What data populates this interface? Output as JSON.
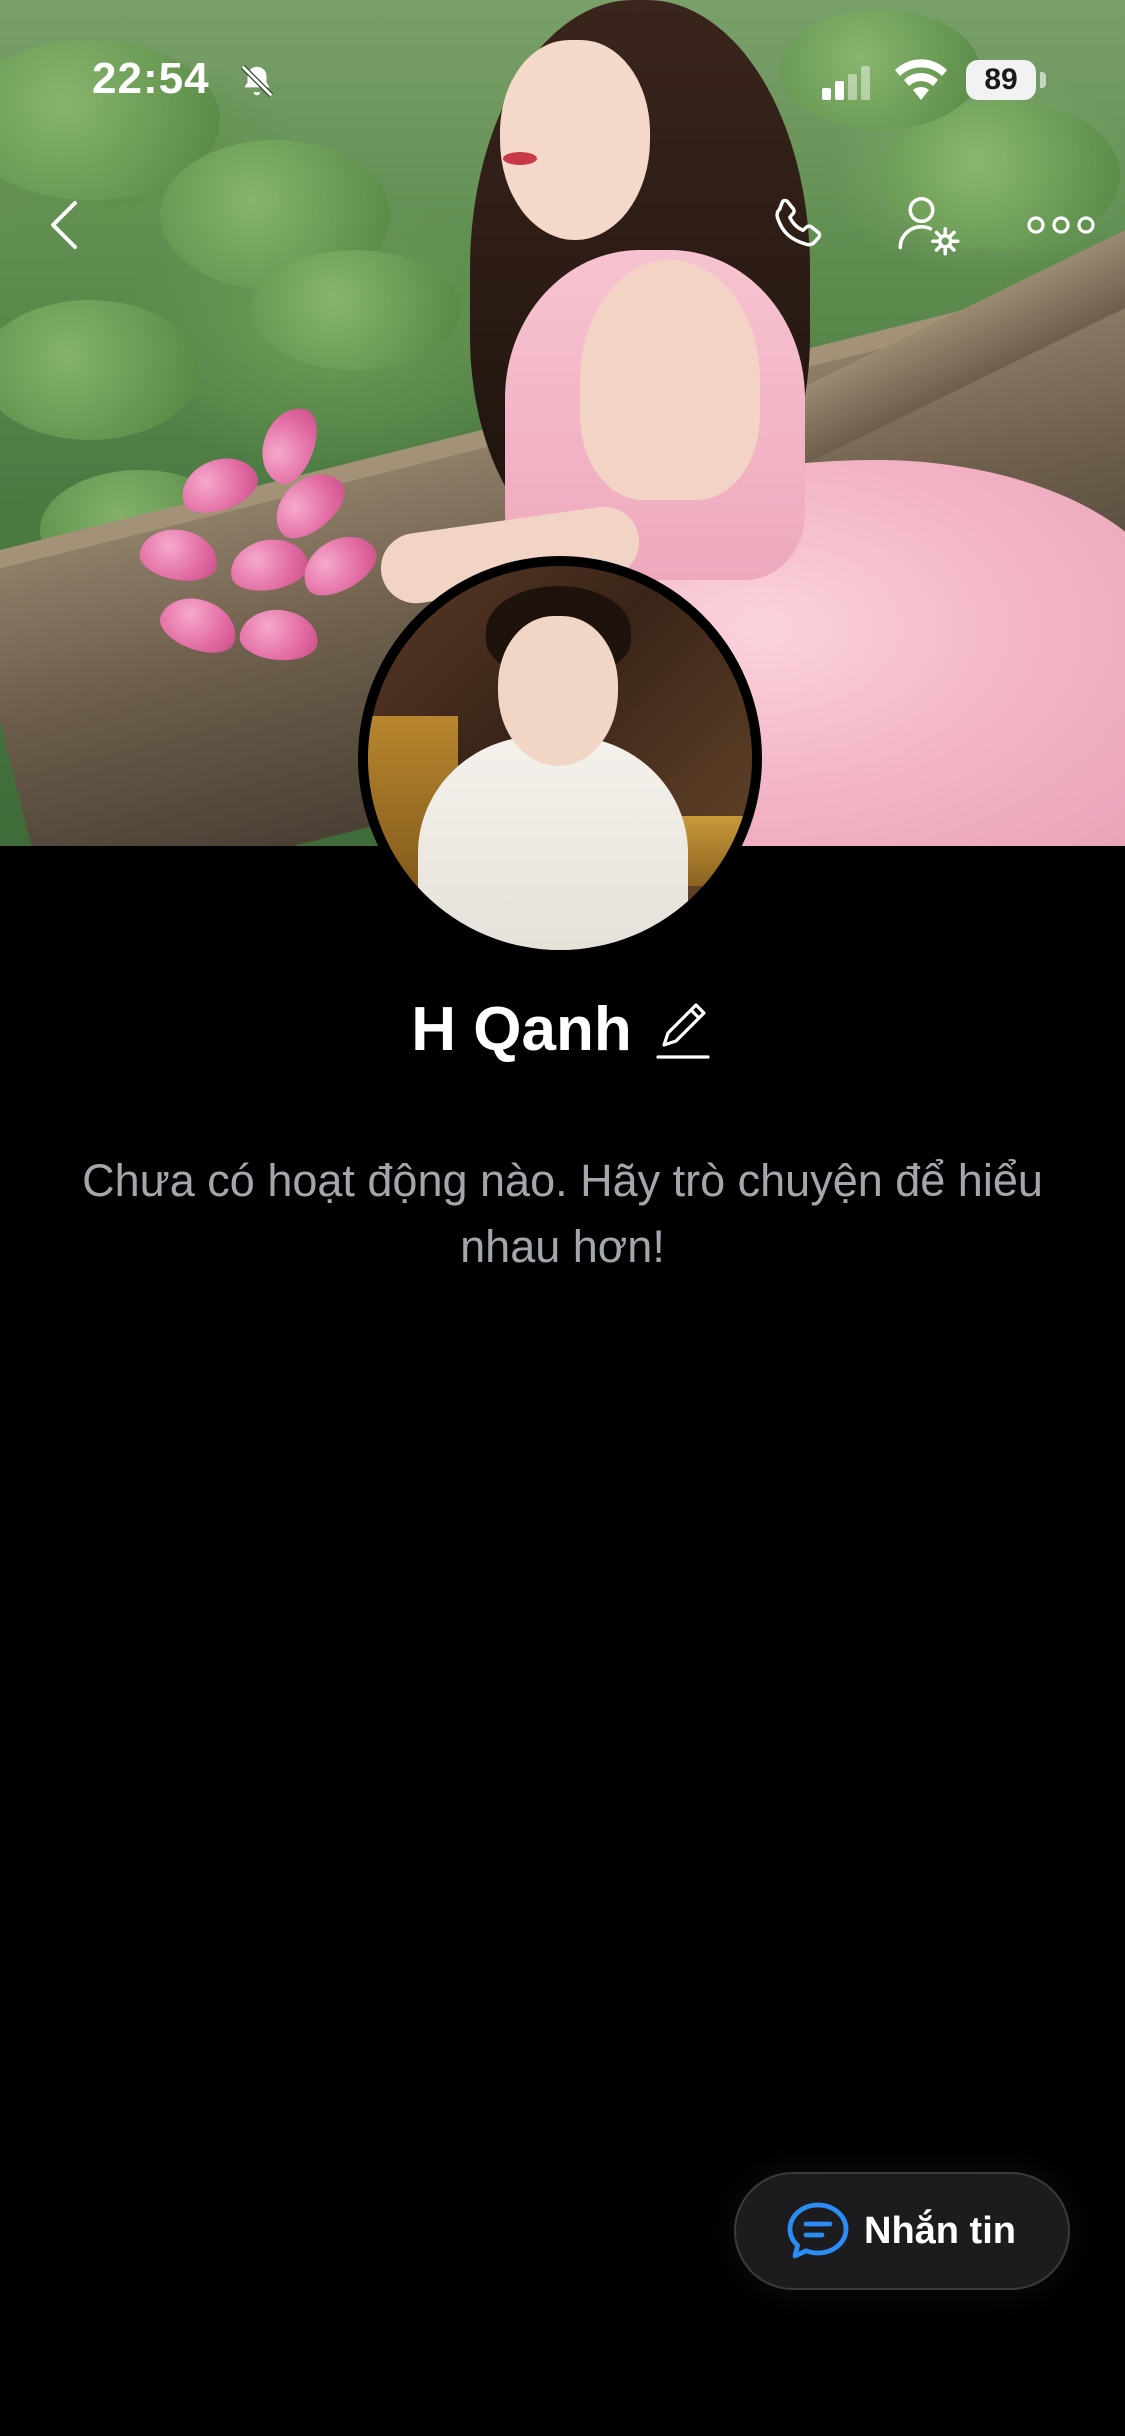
{
  "status_bar": {
    "time": "22:54",
    "battery": "89",
    "icons": [
      "bell-slash-icon",
      "signal-icon",
      "wifi-icon",
      "battery-icon"
    ]
  },
  "nav": {
    "icons": [
      "chevron-left-icon",
      "phone-icon",
      "user-settings-icon",
      "more-icon"
    ]
  },
  "profile": {
    "name": "H Qanh",
    "empty_message": "Chưa có hoạt động nào. Hãy trò chuyện để hiểu nhau hơn!"
  },
  "actions": {
    "message_label": "Nhắn tin"
  },
  "colors": {
    "background": "#000000",
    "accent": "#2c8cf5",
    "muted_text": "#a3a6ab",
    "button_bg": "#1c1c1e"
  }
}
